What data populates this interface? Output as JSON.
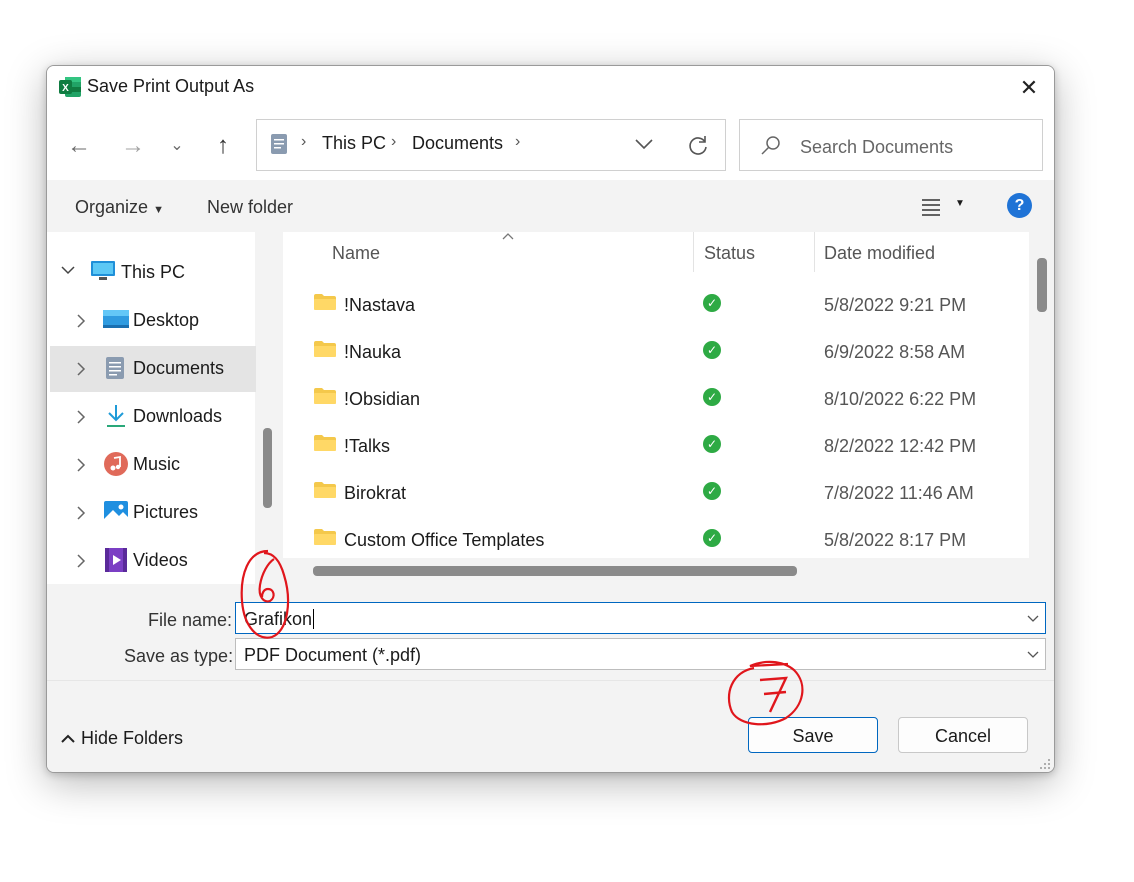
{
  "window": {
    "title": "Save Print Output As"
  },
  "nav": {
    "back_icon": "←",
    "forward_icon": "→",
    "recent_icon": "⌄",
    "up_icon": "↑"
  },
  "address": {
    "crumbs": [
      "This PC",
      "Documents"
    ],
    "separator": "›"
  },
  "search": {
    "placeholder": "Search Documents"
  },
  "toolbar": {
    "organize_label": "Organize",
    "new_folder_label": "New folder",
    "help": "?"
  },
  "sidebar": {
    "root": "This PC",
    "items": [
      {
        "label": "Desktop"
      },
      {
        "label": "Documents",
        "selected": true
      },
      {
        "label": "Downloads"
      },
      {
        "label": "Music"
      },
      {
        "label": "Pictures"
      },
      {
        "label": "Videos"
      }
    ]
  },
  "columns": {
    "name": "Name",
    "status": "Status",
    "date": "Date modified"
  },
  "files": [
    {
      "name": "!Nastava",
      "date": "5/8/2022 9:21 PM"
    },
    {
      "name": "!Nauka",
      "date": "6/9/2022 8:58 AM"
    },
    {
      "name": "!Obsidian",
      "date": "8/10/2022 6:22 PM"
    },
    {
      "name": "!Talks",
      "date": "8/2/2022 12:42 PM"
    },
    {
      "name": "Birokrat",
      "date": "7/8/2022 11:46 AM"
    },
    {
      "name": "Custom Office Templates",
      "date": "5/8/2022 8:17 PM"
    }
  ],
  "form": {
    "filename_label": "File name:",
    "filename_value": "Grafikon",
    "type_label": "Save as type:",
    "type_value": "PDF Document (*.pdf)"
  },
  "footer": {
    "hide_folders_label": "Hide Folders",
    "save_label": "Save",
    "cancel_label": "Cancel"
  },
  "annotations": [
    "6",
    "7"
  ],
  "colors": {
    "accent": "#0067c0",
    "status_green": "#2eaa44",
    "annotation_red": "#e0161c",
    "folder": "#f4c84b"
  }
}
